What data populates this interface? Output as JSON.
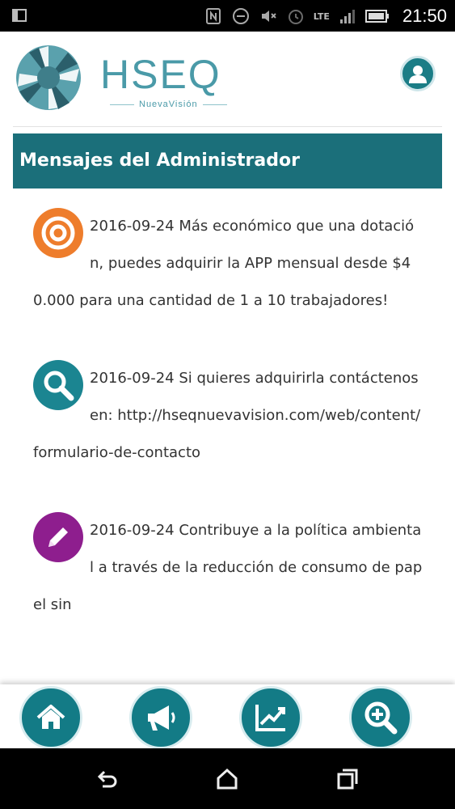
{
  "status_bar": {
    "time": "21:50",
    "network": "LTE"
  },
  "header": {
    "brand": "HSEQ",
    "brand_sub": "NuevaVisión",
    "logo_icon": "shutter-logo-icon",
    "profile_icon": "user-icon"
  },
  "section": {
    "title": "Mensajes del Administrador"
  },
  "messages": [
    {
      "icon": "target-icon",
      "icon_color": "#ee7d2c",
      "text": "2016-09-24 Más económico que una dotación, puedes adquirir la APP mensual desde $40.000 para una cantidad de 1 a 10 trabajadores!"
    },
    {
      "icon": "search-icon",
      "icon_color": "#1b8591",
      "text": "2016-09-24 Si quieres adquirirla contáctenos en: http://hseqnuevavision.com/web/content/formulario-de-contacto"
    },
    {
      "icon": "pencil-icon",
      "icon_color": "#8e1e8e",
      "text": "2016-09-24 Contribuye a la política ambiental a través de la reducción de consumo de papel sin"
    }
  ],
  "bottom_nav": [
    {
      "icon": "home-icon"
    },
    {
      "icon": "megaphone-icon"
    },
    {
      "icon": "chart-icon"
    },
    {
      "icon": "zoom-in-icon"
    }
  ],
  "colors": {
    "teal_dark": "#1b6f7a",
    "teal": "#137b86",
    "brand": "#4a9aa8"
  }
}
